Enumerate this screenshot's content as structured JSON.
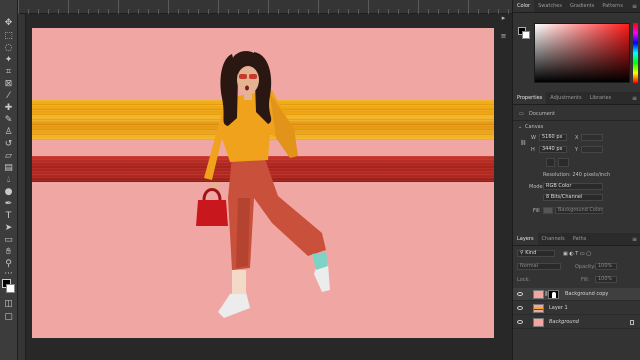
{
  "panels": {
    "color_tabs": [
      "Color",
      "Swatches",
      "Gradients",
      "Patterns"
    ],
    "properties_tabs": [
      "Properties",
      "Adjustments",
      "Libraries"
    ],
    "document_label": "Document",
    "canvas_section": "Canvas",
    "width_label": "W",
    "width_value": "5160 px",
    "height_label": "H",
    "height_value": "3440 px",
    "x_label": "X",
    "y_label": "Y",
    "resolution": "Resolution: 240 pixels/inch",
    "mode_label": "Mode",
    "mode_value": "RGB Color",
    "depth_value": "8 Bits/Channel",
    "fill_label": "Fill",
    "fill_value": "Background Color",
    "layers_tabs": [
      "Layers",
      "Channels",
      "Paths"
    ],
    "kind_filter": "Kind",
    "blend_mode": "Normal",
    "opacity_label": "Opacity:",
    "opacity_value": "100%",
    "lock_label": "Lock:",
    "fill2_label": "Fill:",
    "fill2_value": "100%",
    "layers": [
      {
        "name": "Background copy"
      },
      {
        "name": "Layer 1"
      },
      {
        "name": "Background"
      }
    ]
  },
  "colors": {
    "canvas_bg": "#f0a7a3",
    "stripe_orange": "#f3b01d",
    "stripe_red": "#a8221b",
    "accent_blue": "#2f80d1"
  },
  "icons": [
    "move-icon",
    "marquee-icon",
    "lasso-icon",
    "magic-wand-icon",
    "crop-icon",
    "frame-icon",
    "eyedropper-icon",
    "healing-brush-icon",
    "brush-icon",
    "clone-stamp-icon",
    "history-brush-icon",
    "eraser-icon",
    "gradient-icon",
    "blur-icon",
    "dodge-icon",
    "pen-icon",
    "type-icon",
    "path-select-icon",
    "shape-icon",
    "hand-icon",
    "zoom-icon",
    "more-tools-icon"
  ]
}
